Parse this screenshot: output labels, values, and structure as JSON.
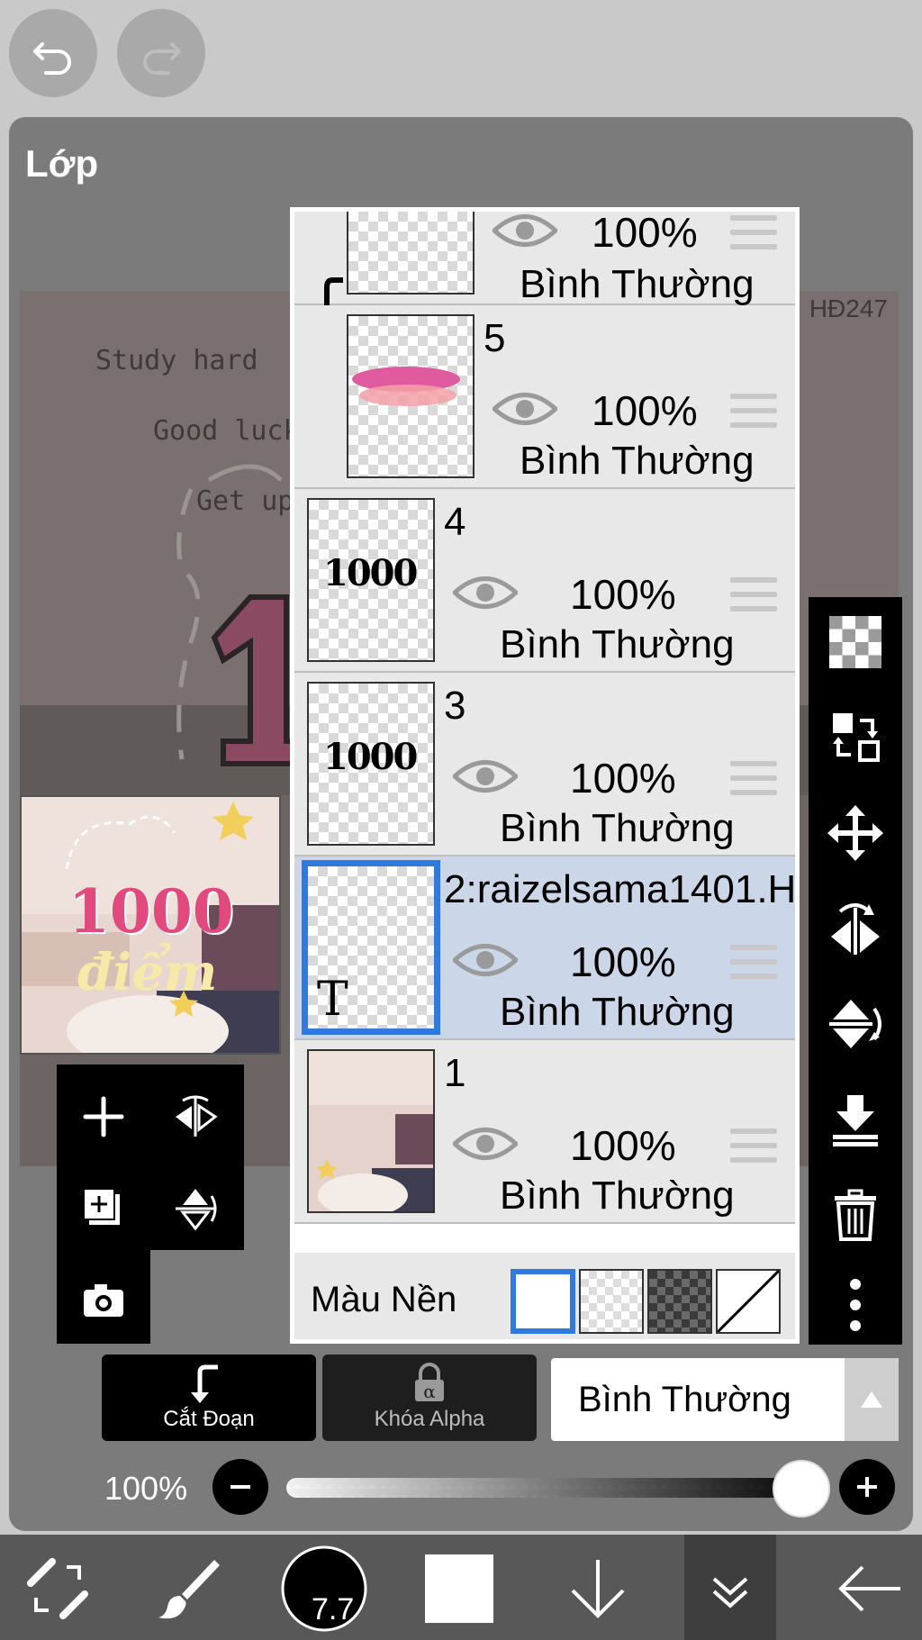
{
  "window": {
    "title": "Lớp"
  },
  "canvas_preview": {
    "lines": [
      "Study hard",
      "Good luck",
      "Get up"
    ],
    "watermark": "HĐ247"
  },
  "thumbnail": {
    "big_text": "1000",
    "sub_text": "điểm"
  },
  "layers": [
    {
      "name": "",
      "opacity": "100%",
      "mode": "Bình Thường",
      "thumb_text": ""
    },
    {
      "name": "5",
      "opacity": "100%",
      "mode": "Bình Thường",
      "thumb_text": ""
    },
    {
      "name": "4",
      "opacity": "100%",
      "mode": "Bình Thường",
      "thumb_text": "1000"
    },
    {
      "name": "3",
      "opacity": "100%",
      "mode": "Bình Thường",
      "thumb_text": "1000"
    },
    {
      "name": "2:raizelsama1401.H",
      "opacity": "100%",
      "mode": "Bình Thường",
      "thumb_text": "T",
      "selected": true
    },
    {
      "name": "1",
      "opacity": "100%",
      "mode": "Bình Thường",
      "thumb_text": ""
    }
  ],
  "background_color": {
    "label": "Màu Nền",
    "options": [
      "white",
      "transparent-light",
      "transparent-dark",
      "none"
    ],
    "selected": "white"
  },
  "blend_bar": {
    "clip_label": "Cắt Đoạn",
    "alpha_lock_label": "Khóa Alpha",
    "blend_mode": "Bình Thường"
  },
  "opacity_slider": {
    "label": "100%",
    "value": 1.0
  },
  "brush": {
    "size": "7.7"
  },
  "colors": {
    "accent_blue": "#2f79e0",
    "selected_row": "#cbd7e9",
    "panel": "#7b7b7b"
  },
  "icons": {
    "top": [
      "undo-icon",
      "redo-icon"
    ],
    "right_tools": [
      "transparency-icon",
      "swap-layers-icon",
      "move-icon",
      "flip-horizontal-icon",
      "flip-vertical-icon",
      "merge-down-icon",
      "trash-icon",
      "more-icon"
    ],
    "mini_tools": [
      "add-layer-icon",
      "flip-horizontal-icon",
      "duplicate-layer-icon",
      "flip-vertical-icon",
      "camera-icon"
    ],
    "bottom": [
      "transform-icon",
      "brush-icon",
      "brush-size-icon",
      "color-icon",
      "arrow-down-icon",
      "layers-icon",
      "back-icon"
    ]
  }
}
